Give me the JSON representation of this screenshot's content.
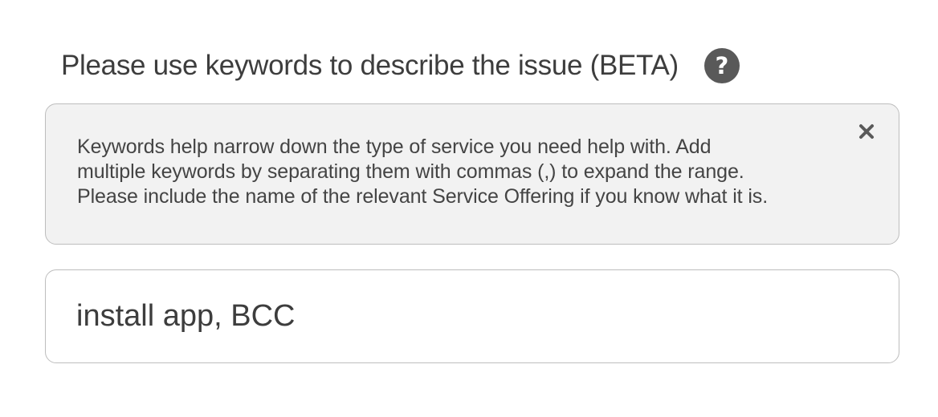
{
  "field": {
    "label": "Please use keywords to describe the issue (BETA)",
    "help_icon": "question-mark-circle-icon",
    "help_glyph": "?"
  },
  "info": {
    "lines": [
      "Keywords help narrow down the type of service you need help with. Add",
      "multiple keywords by separating them with commas (,) to expand the range.",
      "Please include the name of the relevant Service Offering if you know what it is."
    ],
    "close_icon": "close-icon"
  },
  "input": {
    "value": "install app, BCC",
    "placeholder": ""
  },
  "colors": {
    "info_background": "#f2f2f2",
    "border": "#bdbdbd",
    "icon": "#595959",
    "text": "#3d3d3d"
  }
}
